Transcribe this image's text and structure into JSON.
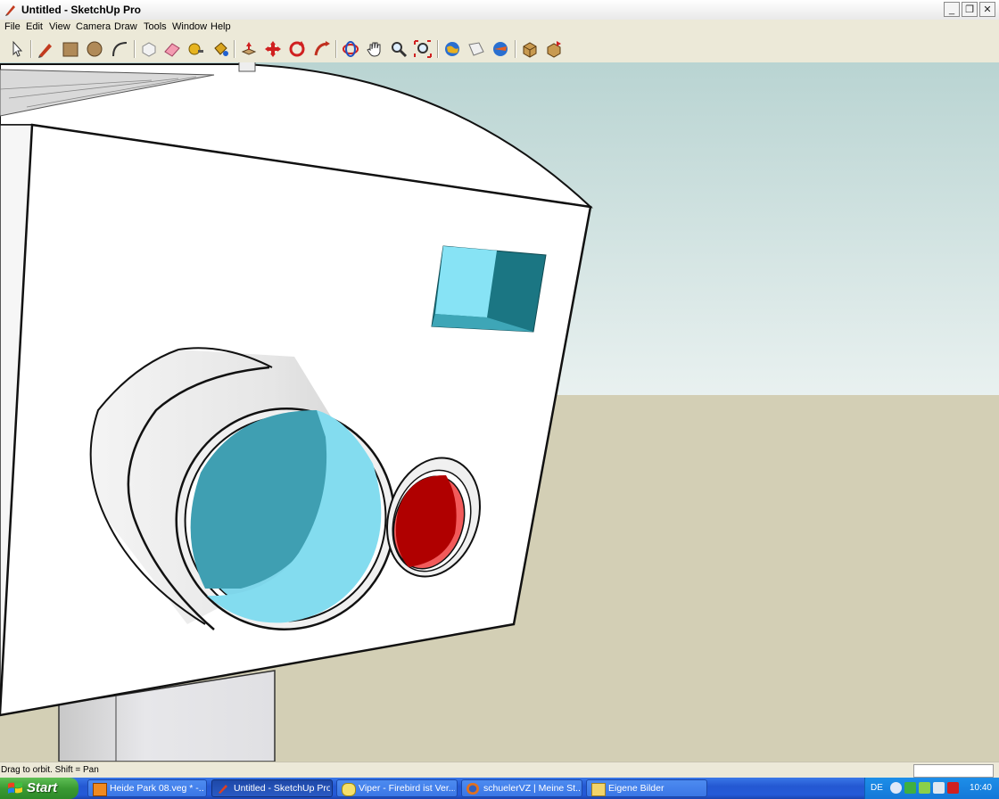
{
  "window": {
    "title": "Untitled - SketchUp Pro",
    "min_symbol": "_",
    "max_symbol": "❐",
    "close_symbol": "✕"
  },
  "menu": [
    "File",
    "Edit",
    "View",
    "Camera",
    "Draw",
    "Tools",
    "Window",
    "Help"
  ],
  "toolbar": {
    "tools": [
      "select-icon",
      "pencil-icon",
      "rectangle-icon",
      "circle-icon",
      "arc-icon",
      "make-component-icon",
      "eraser-icon",
      "tape-measure-icon",
      "paint-bucket-icon",
      "push-pull-icon",
      "move-icon",
      "rotate-icon",
      "follow-me-icon",
      "orbit-icon",
      "pan-icon",
      "zoom-icon",
      "zoom-extents-icon",
      "get-models-icon",
      "share-model-icon",
      "google-earth-icon",
      "components-icon",
      "share-component-icon"
    ]
  },
  "status": {
    "hint": "Drag to orbit.  Shift = Pan"
  },
  "taskbar": {
    "start_label": "Start",
    "tasks": [
      {
        "label": "Heide Park 08.veg * -...",
        "icon": "vegas-icon",
        "active": false
      },
      {
        "label": "Untitled - SketchUp Pro",
        "icon": "sketchup-icon",
        "active": true
      },
      {
        "label": "Viper - Firebird ist Ver...",
        "icon": "chat-icon",
        "active": false
      },
      {
        "label": "schuelerVZ | Meine St...",
        "icon": "firefox-icon",
        "active": false
      },
      {
        "label": "Eigene Bilder",
        "icon": "folder-icon",
        "active": false
      }
    ],
    "tray_lang": "DE",
    "clock": "10:40"
  },
  "colors": {
    "sky_top": "#b7d2d0",
    "sky_bottom": "#e8f0ef",
    "ground": "#d4d0b6",
    "lens_blue": "#7fd4e8",
    "lens_red": "#b00000",
    "accent_teal": "#1b7683"
  }
}
